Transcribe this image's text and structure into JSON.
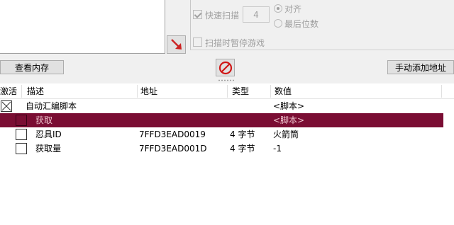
{
  "options": {
    "fast_scan_label": "快速扫描",
    "fast_scan_value": "4",
    "align_label": "对齐",
    "last_digits_label": "最后位数",
    "pause_game_label": "扫描时暂停游戏"
  },
  "toolbar": {
    "view_memory_label": "查看内存",
    "add_address_label": "手动添加地址"
  },
  "table": {
    "columns": [
      "激活",
      "描述",
      "地址",
      "类型",
      "数值"
    ],
    "rows": [
      {
        "desc": "自动汇编脚本",
        "address": "",
        "type": "",
        "value": "<脚本>"
      },
      {
        "desc": "获取",
        "address": "",
        "type": "",
        "value": "<脚本>"
      },
      {
        "desc": "忍具ID",
        "address": "7FFD3EAD0019",
        "type": "4 字节",
        "value": "火箭筒"
      },
      {
        "desc": "获取量",
        "address": "7FFD3EAD001D",
        "type": "4 字节",
        "value": "-1"
      }
    ]
  },
  "colors": {
    "selected_row": "#7a0d33",
    "selected_text": "#f0c7d0",
    "arrow": "#cc2222",
    "stop_icon": "#d01818"
  }
}
